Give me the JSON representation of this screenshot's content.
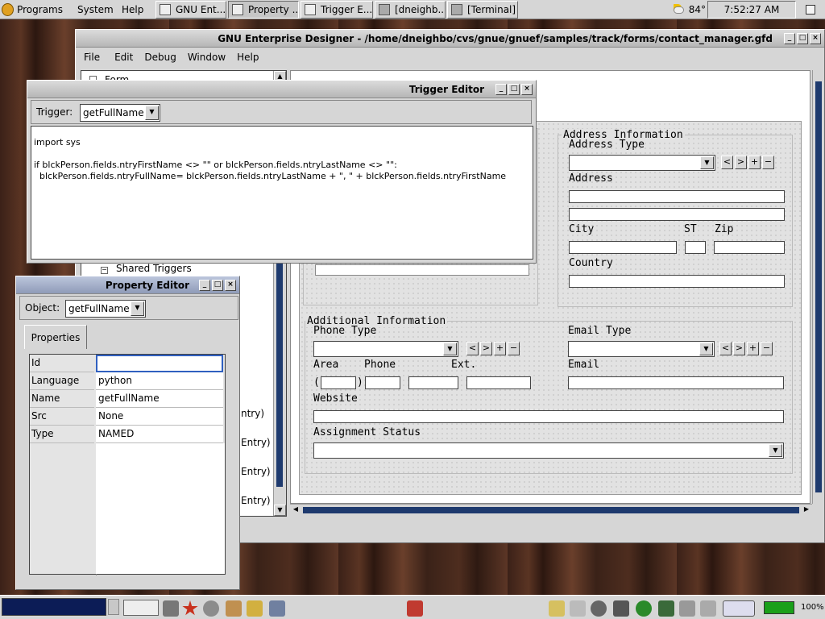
{
  "taskbar": {
    "menus": [
      "Programs",
      "System",
      "Help"
    ],
    "tasks": [
      "GNU Ent...",
      "Property ...",
      "Trigger E...",
      "[dneighb...]",
      "[Terminal]"
    ],
    "temperature": "84°",
    "clock": "7:52:27 AM"
  },
  "designer": {
    "title": "GNU Enterprise Designer - /home/dneighbo/cvs/gnue/gnuef/samples/track/forms/contact_manager.gfd",
    "menu": [
      "File",
      "Edit",
      "Debug",
      "Window",
      "Help"
    ],
    "tree": {
      "form_item": "Form",
      "shared_triggers": "Shared Triggers",
      "entry_items": [
        "ntry)",
        "Entry)",
        "Entry)",
        "Entry)"
      ]
    }
  },
  "form": {
    "address_box": {
      "title": "Address Information",
      "address_type": "Address Type",
      "address": "Address",
      "city": "City",
      "st": "ST",
      "zip": "Zip",
      "country": "Country"
    },
    "additional_box": {
      "title": "Additional Information",
      "phone_type": "Phone Type",
      "email_type": "Email Type",
      "area": "Area",
      "phone": "Phone",
      "ext": "Ext.",
      "open_paren": "(",
      "close_paren": ")",
      "email": "Email",
      "website": "Website",
      "assignment_status": "Assignment Status"
    },
    "nav_buttons": [
      "<",
      ">",
      "+",
      "−"
    ]
  },
  "trigger_editor": {
    "title": "Trigger Editor",
    "trigger_label": "Trigger:",
    "trigger_value": "getFullName",
    "code": [
      "import sys",
      "",
      "if blckPerson.fields.ntryFirstName <> \"\" or blckPerson.fields.ntryLastName <> \"\":",
      "  blckPerson.fields.ntryFullName= blckPerson.fields.ntryLastName + \", \" + blckPerson.fields.ntryFirstName"
    ]
  },
  "property_editor": {
    "title": "Property Editor",
    "object_label": "Object:",
    "object_value": "getFullName",
    "tab": "Properties",
    "rows": [
      {
        "label": "Id",
        "value": ""
      },
      {
        "label": "Language",
        "value": "python"
      },
      {
        "label": "Name",
        "value": "getFullName"
      },
      {
        "label": "Src",
        "value": "None"
      },
      {
        "label": "Type",
        "value": "NAMED"
      }
    ]
  },
  "bottom_panel": {
    "battery": "100%"
  },
  "icons": {
    "gnome_foot": "gnome-foot-icon",
    "weather": "weather-cloud-icon",
    "window_task": "window-task-icon",
    "terminal_task": "terminal-task-icon"
  }
}
